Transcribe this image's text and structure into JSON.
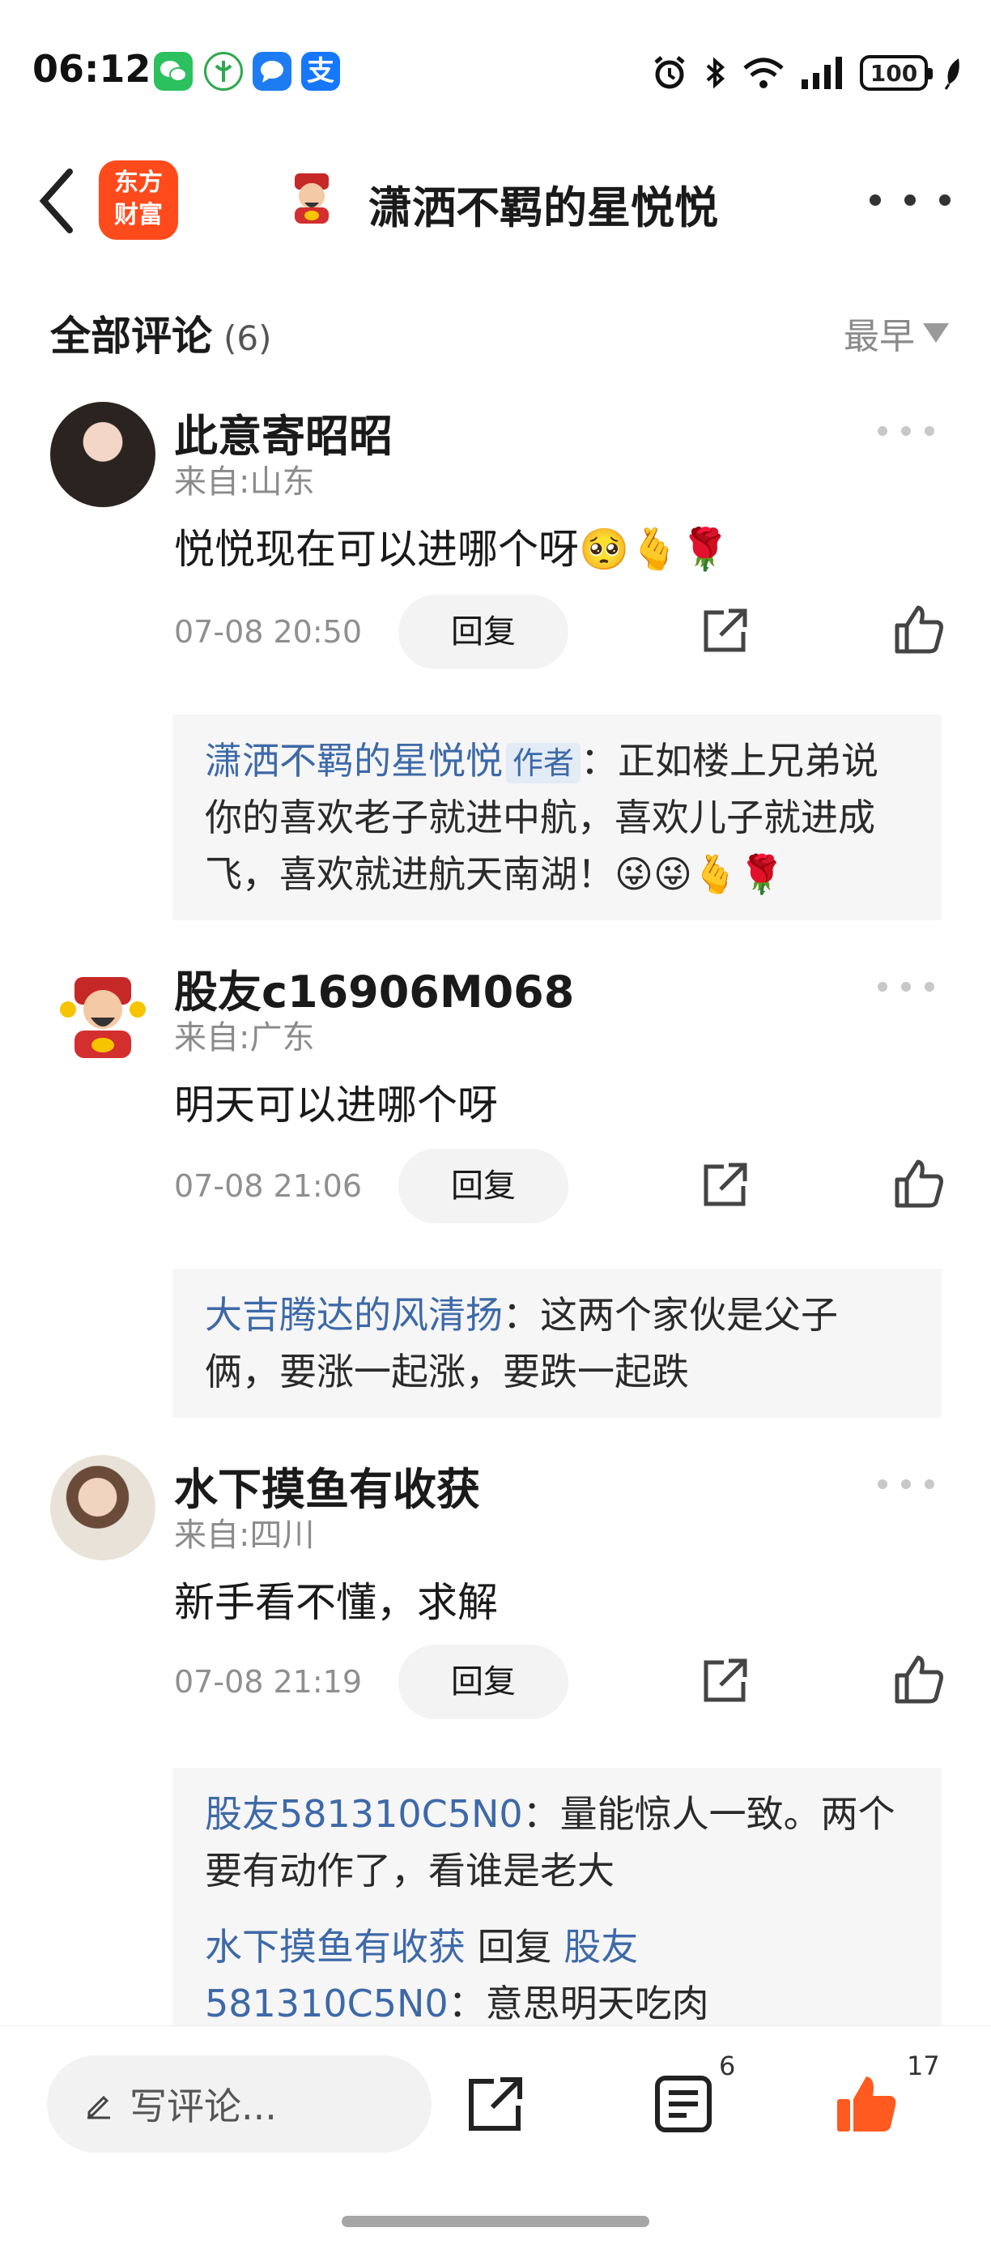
{
  "status_bar": {
    "time": "06:12",
    "battery": "100",
    "app_icons": [
      "wechat-icon",
      "network-icon",
      "chat-bubble-icon",
      "alipay-icon"
    ],
    "right_icons": [
      "alarm-icon",
      "bluetooth-icon",
      "wifi-icon",
      "signal-icon",
      "battery-icon",
      "leaf-icon"
    ]
  },
  "nav": {
    "logo_line1": "东方",
    "logo_line2": "财富",
    "title": "潇洒不羁的星悦悦"
  },
  "comments_header": {
    "title": "全部评论",
    "count": "(6)",
    "sort_label": "最早"
  },
  "comments": [
    {
      "username": "此意寄昭昭",
      "location": "来自:山东",
      "text": "悦悦现在可以进哪个呀🥺🫰🌹",
      "time": "07-08 20:50",
      "reply_label": "回复",
      "replies": [
        {
          "name": "潇洒不羁的星悦悦",
          "tag": "作者",
          "sep": "：",
          "text": "正如楼上兄弟说你的喜欢老子就进中航，喜欢儿子就进成飞，喜欢就进航天南湖！😜😜🫰🌹"
        }
      ]
    },
    {
      "username": "股友c16906M068",
      "location": "来自:广东",
      "text": "明天可以进哪个呀",
      "time": "07-08 21:06",
      "reply_label": "回复",
      "replies": [
        {
          "name": "大吉腾达的风清扬",
          "sep": "：",
          "text": "这两个家伙是父子俩，要涨一起涨，要跌一起跌"
        }
      ]
    },
    {
      "username": "水下摸鱼有收获",
      "location": "来自:四川",
      "text": "新手看不懂，求解",
      "time": "07-08 21:19",
      "reply_label": "回复",
      "replies": [
        {
          "name": "股友581310C5N0",
          "sep": "：",
          "text": "量能惊人一致。两个要有动作了，看谁是老大"
        },
        {
          "name": "水下摸鱼有收获",
          "mid": " 回复 ",
          "target": "股友581310C5N0",
          "sep": "：",
          "text": "意思明天吃肉"
        }
      ]
    }
  ],
  "bottom_bar": {
    "write_placeholder": "写评论...",
    "comment_count": "6",
    "like_count": "17"
  },
  "colors": {
    "accent": "#ff5a1f",
    "link": "#3d69a8",
    "logo_bg": "#ff4a1c"
  }
}
